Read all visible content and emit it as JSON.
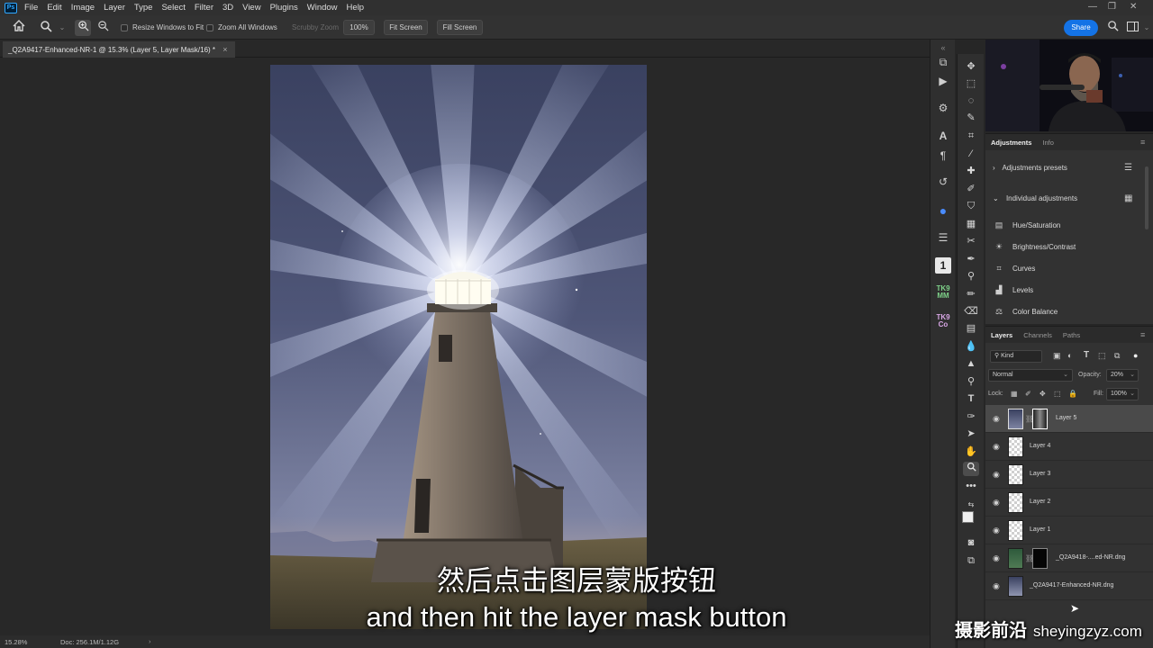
{
  "menubar": {
    "items": [
      "File",
      "Edit",
      "Image",
      "Layer",
      "Type",
      "Select",
      "Filter",
      "3D",
      "View",
      "Plugins",
      "Window",
      "Help"
    ]
  },
  "options": {
    "resize_windows": "Resize Windows to Fit",
    "zoom_all": "Zoom All Windows",
    "scrubby": "Scrubby Zoom",
    "zoom_btn": "100%",
    "fit_btn": "Fit Screen",
    "fill_btn": "Fill Screen",
    "share": "Share"
  },
  "document": {
    "tab_title": "_Q2A9417-Enhanced-NR-1 @ 15.3% (Layer 5, Layer Mask/16) *",
    "close": "×"
  },
  "status": {
    "zoom": "15.28%",
    "doc": "Doc: 256.1M/1.12G"
  },
  "subtitles": {
    "cn": "然后点击图层蒙版按钮",
    "en": "and then hit the layer mask button"
  },
  "adjustments": {
    "tabs": [
      "Adjustments",
      "Info"
    ],
    "presets": "Adjustments presets",
    "individual": "Individual adjustments",
    "items": [
      "Hue/Saturation",
      "Brightness/Contrast",
      "Curves",
      "Levels",
      "Color Balance"
    ]
  },
  "layers": {
    "tabs": [
      "Layers",
      "Channels",
      "Paths"
    ],
    "kind": "Kind",
    "blend": "Normal",
    "opacity_label": "Opacity:",
    "opacity": "20%",
    "lock": "Lock:",
    "fill_label": "Fill:",
    "fill": "100%",
    "rows": [
      {
        "name": "Layer 5"
      },
      {
        "name": "Layer 4"
      },
      {
        "name": "Layer 3"
      },
      {
        "name": "Layer 2"
      },
      {
        "name": "Layer 1"
      },
      {
        "name": "_Q2A9418-....ed-NR.dng"
      },
      {
        "name": "_Q2A9417-Enhanced-NR.dng"
      }
    ]
  },
  "watermark": {
    "cn": "摄影前沿",
    "url": "sheyingzyz.com"
  },
  "colors": {
    "accent": "#1473e6",
    "sky_top": "#3a4160",
    "sky_bottom": "#8f95b0"
  }
}
